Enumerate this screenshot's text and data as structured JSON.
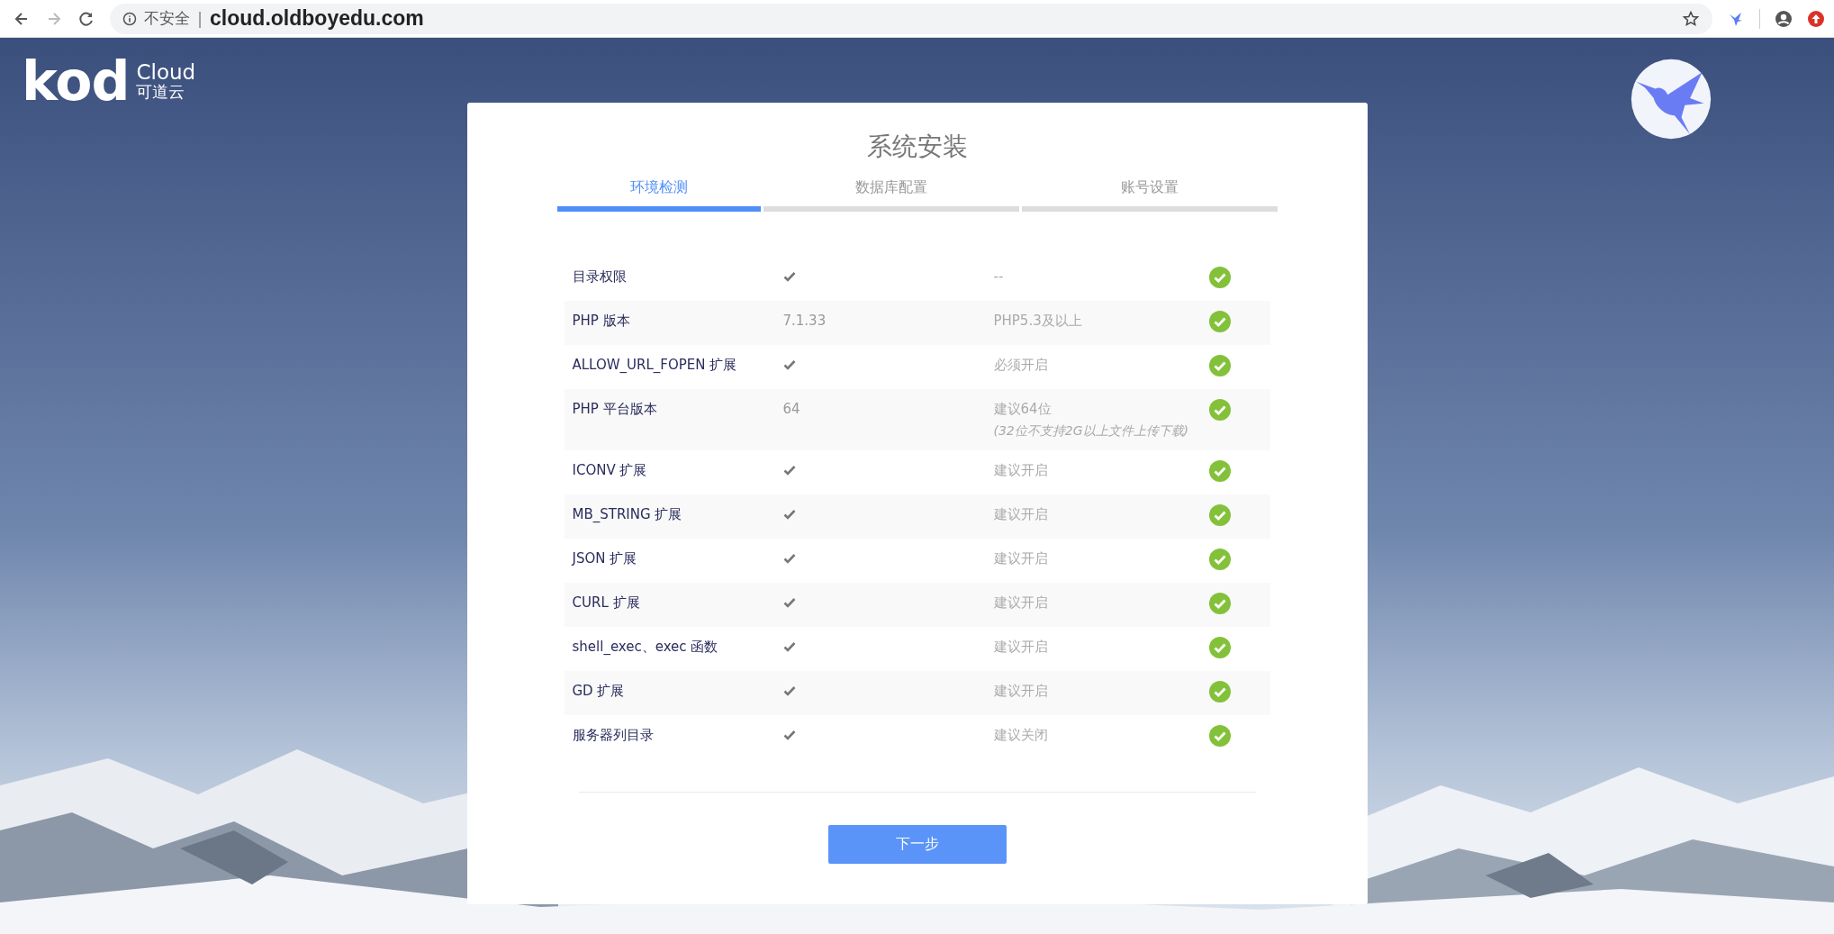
{
  "browser": {
    "security_label": "不安全",
    "separator": "|",
    "url": "cloud.oldboyedu.com",
    "forward_disabled": true
  },
  "logo": {
    "mark": "kod",
    "name": "Cloud",
    "subtitle": "可道云"
  },
  "card": {
    "title": "系统安装",
    "steps": [
      {
        "label": "环境检测",
        "selected": true
      },
      {
        "label": "数据库配置",
        "selected": false
      },
      {
        "label": "账号设置",
        "selected": false
      }
    ],
    "checks": [
      {
        "name": "目录权限",
        "kind": "check",
        "requirement": "--",
        "ok": true
      },
      {
        "name": "PHP 版本",
        "kind": "text",
        "value": "7.1.33",
        "requirement": "PHP5.3及以上",
        "ok": true
      },
      {
        "name": "ALLOW_URL_FOPEN 扩展",
        "kind": "check",
        "requirement": "必须开启",
        "ok": true
      },
      {
        "name": "PHP 平台版本",
        "kind": "text",
        "value": "64",
        "requirement": "建议64位",
        "note": "(32位不支持2G以上文件上传下载)",
        "ok": true
      },
      {
        "name": "ICONV 扩展",
        "kind": "check",
        "requirement": "建议开启",
        "ok": true
      },
      {
        "name": "MB_STRING 扩展",
        "kind": "check",
        "requirement": "建议开启",
        "ok": true
      },
      {
        "name": "JSON 扩展",
        "kind": "check",
        "requirement": "建议开启",
        "ok": true
      },
      {
        "name": "CURL 扩展",
        "kind": "check",
        "requirement": "建议开启",
        "ok": true
      },
      {
        "name": "shell_exec、exec 函数",
        "kind": "check",
        "requirement": "建议开启",
        "ok": true
      },
      {
        "name": "GD 扩展",
        "kind": "check",
        "requirement": "建议开启",
        "ok": true
      },
      {
        "name": "服务器列目录",
        "kind": "check",
        "requirement": "建议关闭",
        "ok": true
      }
    ],
    "next_button": "下一步"
  }
}
